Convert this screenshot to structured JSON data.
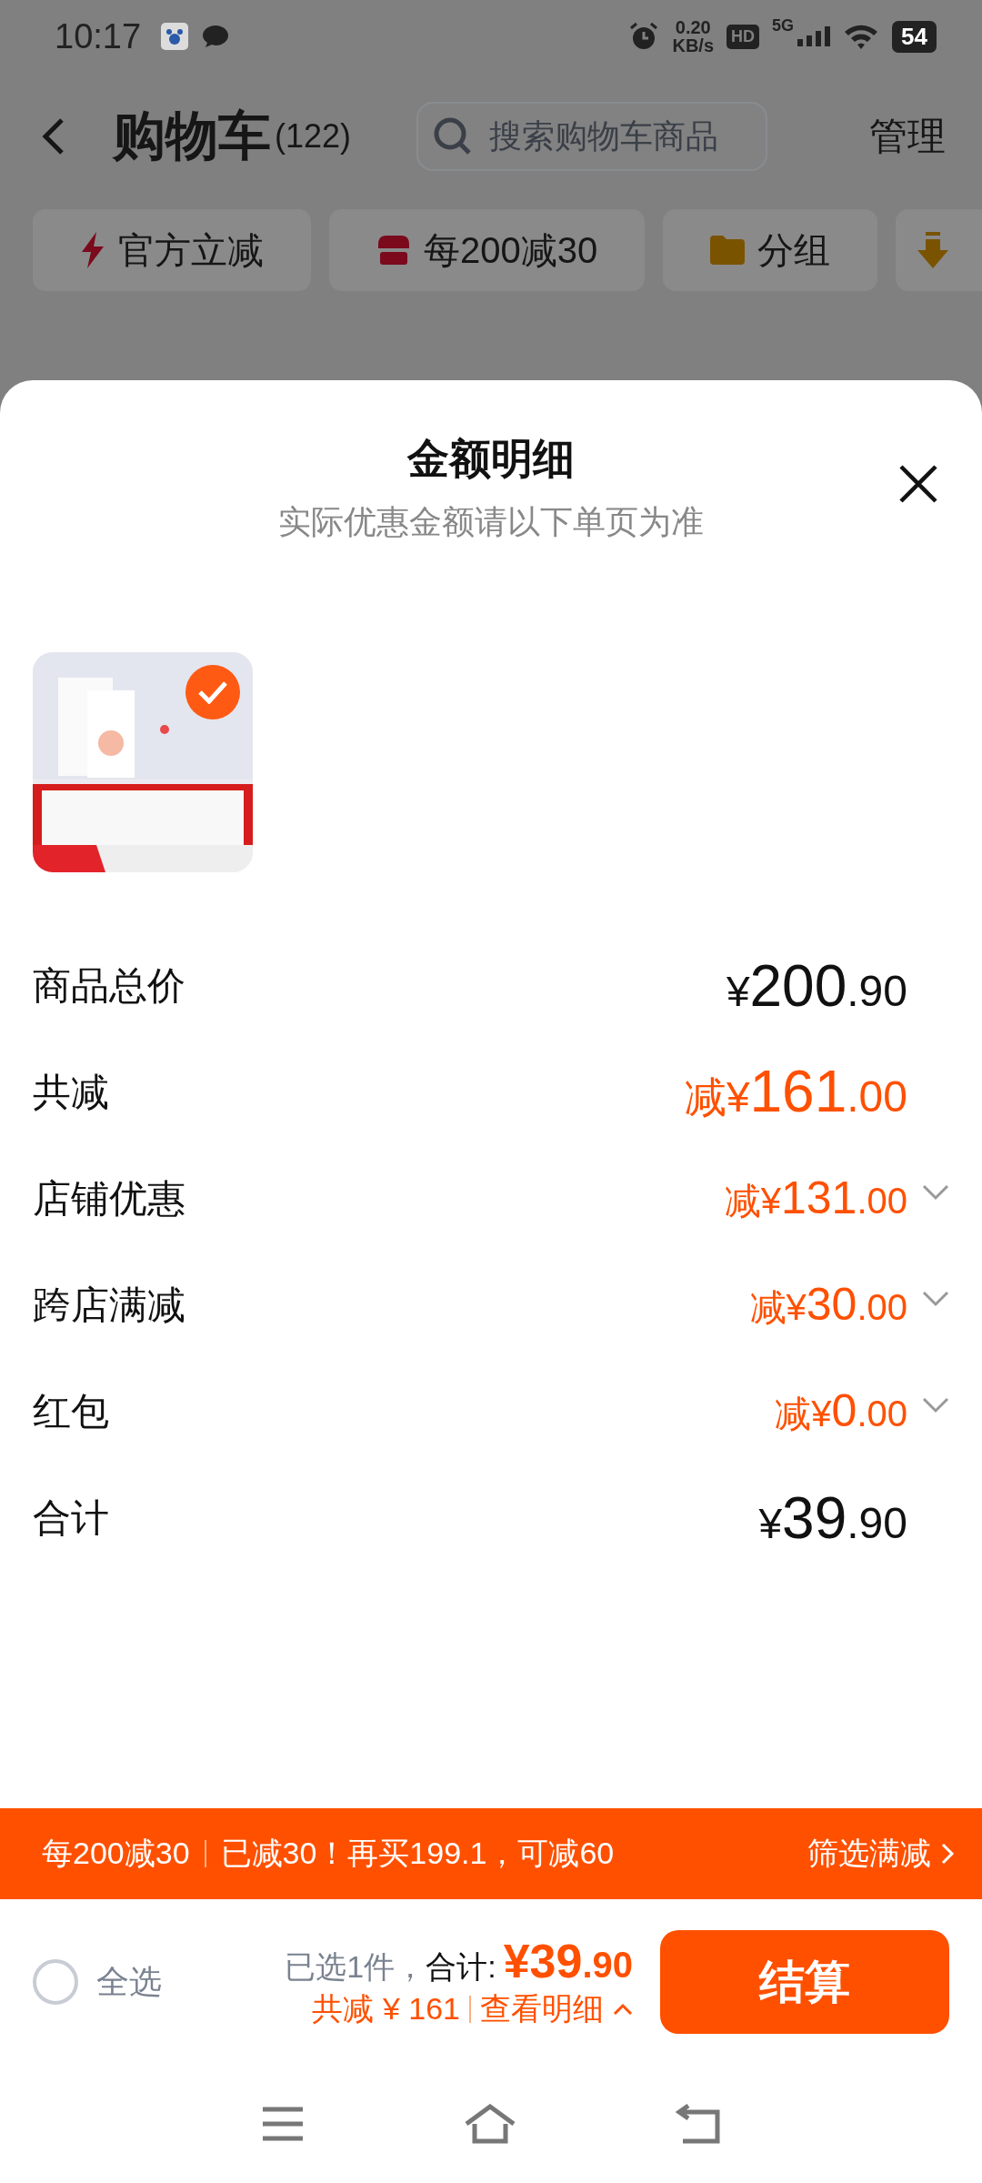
{
  "status_bar": {
    "time": "10:17",
    "speed": "0.20",
    "speed_unit": "KB/s",
    "hd": "HD",
    "network": "5G",
    "battery": "54"
  },
  "header": {
    "title": "购物车",
    "count": "(122)",
    "search": {
      "placeholder": "搜索购物车商品"
    },
    "manage": "管理"
  },
  "chips": [
    {
      "label": "官方立减",
      "kind": "bolt"
    },
    {
      "label": "每200减30",
      "kind": "shop"
    },
    {
      "label": "分组",
      "kind": "folder"
    }
  ],
  "sheet": {
    "title": "金额明细",
    "subtitle": "实际优惠金额请以下单页为准",
    "products": [
      {
        "kind": "picture",
        "selected": true
      }
    ],
    "rows": [
      {
        "label": "商品总价",
        "kind": "total",
        "prefix": "¥",
        "integer": "200",
        "decimal": ".90"
      },
      {
        "label": "共减",
        "kind": "discount",
        "prefix": "减¥",
        "integer": "161",
        "decimal": ".00"
      },
      {
        "label": "店铺优惠",
        "kind": "detail",
        "prefix": "减¥",
        "integer": "131",
        "decimal": ".00"
      },
      {
        "label": "跨店满减",
        "kind": "detail",
        "prefix": "减¥",
        "integer": "30",
        "decimal": ".00"
      },
      {
        "label": "红包",
        "kind": "detail",
        "prefix": "减¥",
        "integer": "0",
        "decimal": ".00"
      },
      {
        "label": "合计",
        "kind": "total",
        "prefix": "¥",
        "integer": "39",
        "decimal": ".90"
      }
    ]
  },
  "promo_banner": {
    "rule": "每200减30",
    "message": "已减30！再买199.1，可减60",
    "link": "筛选满减"
  },
  "checkout_bar": {
    "select_all": {
      "label": "全选",
      "checked": false
    },
    "selected_count": "已选1件，",
    "total_label": "合计:",
    "total_integer": "¥39",
    "total_decimal": ".90",
    "saved": "共减 ¥ 161",
    "details_link": "查看明细",
    "button": "结算"
  }
}
